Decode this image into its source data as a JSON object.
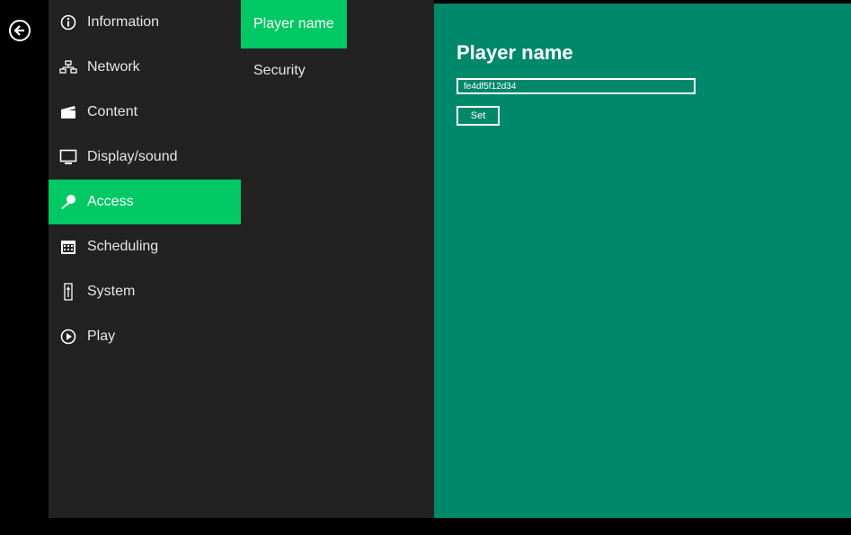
{
  "nav": {
    "items": [
      {
        "label": "Information",
        "icon": "info-icon"
      },
      {
        "label": "Network",
        "icon": "network-icon"
      },
      {
        "label": "Content",
        "icon": "clapperboard-icon"
      },
      {
        "label": "Display/sound",
        "icon": "monitor-icon"
      },
      {
        "label": "Access",
        "icon": "key-icon",
        "active": true
      },
      {
        "label": "Scheduling",
        "icon": "calendar-icon"
      },
      {
        "label": "System",
        "icon": "tuning-fork-icon"
      },
      {
        "label": "Play",
        "icon": "play-icon"
      }
    ]
  },
  "subnav": {
    "items": [
      {
        "label": "Player name",
        "active": true
      },
      {
        "label": "Security"
      }
    ]
  },
  "main": {
    "title": "Player name",
    "input_value": "fe4df5f12d34",
    "set_label": "Set"
  },
  "colors": {
    "accent": "#00c864",
    "panel": "#00886a",
    "sidebar": "#222222",
    "rail": "#000000"
  }
}
